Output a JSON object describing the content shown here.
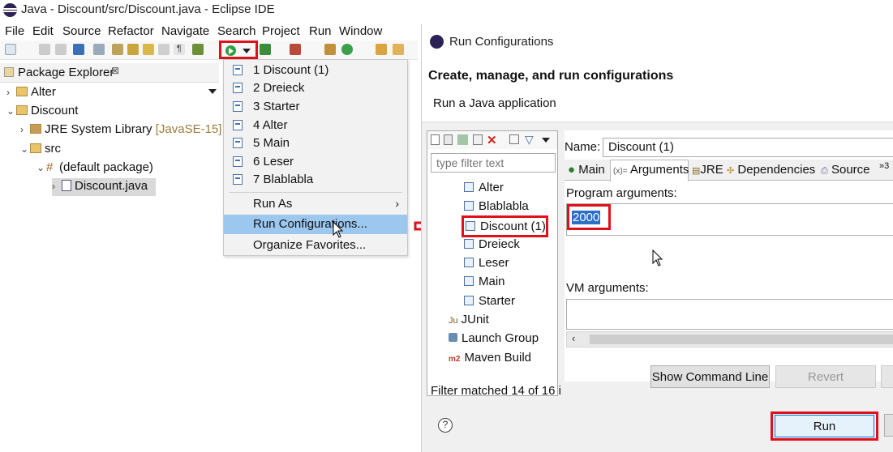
{
  "eclipse": {
    "window_title": "Java - Discount/src/Discount.java - Eclipse IDE",
    "menu": [
      "File",
      "Edit",
      "Source",
      "Refactor",
      "Navigate",
      "Search",
      "Project",
      "Run",
      "Window"
    ],
    "package_explorer": {
      "title": "Package Explorer",
      "close": "⊠",
      "tree": [
        {
          "label": "Alter",
          "extra": ""
        },
        {
          "label": "Discount",
          "extra": ""
        },
        {
          "label": "JRE System Library",
          "extra": "[JavaSE-15]"
        },
        {
          "label": "src",
          "extra": ""
        },
        {
          "label": "(default package)",
          "extra": ""
        },
        {
          "label": "Discount.java",
          "extra": ""
        }
      ]
    },
    "run_menu": {
      "favorites": [
        "1 Discount (1)",
        "2 Dreieck",
        "3 Starter",
        "4 Alter",
        "5 Main",
        "6 Leser",
        "7 Blablabla"
      ],
      "run_as": "Run As",
      "run_configurations": "Run Configurations...",
      "organize_favorites": "Organize Favorites..."
    }
  },
  "dialog": {
    "title": "Run Configurations",
    "heading": "Create, manage, and run configurations",
    "subheading": "Run a Java application",
    "filter_placeholder": "type filter text",
    "configs": [
      "Alter",
      "Blablabla",
      "Discount (1)",
      "Dreieck",
      "Leser",
      "Main",
      "Starter"
    ],
    "categories": [
      {
        "icon": "Ju",
        "label": "JUnit"
      },
      {
        "icon": "",
        "label": "Launch Group"
      },
      {
        "icon": "m2",
        "label": "Maven Build"
      }
    ],
    "filter_status": "Filter matched 14 of 16 i",
    "name_label": "Name:",
    "name_value": "Discount (1)",
    "tabs": [
      "Main",
      "Arguments",
      "JRE",
      "Dependencies",
      "Source",
      "»3"
    ],
    "program_args_label": "Program arguments:",
    "program_args_value": "2000",
    "vm_args_label": "VM arguments:",
    "show_command_line": "Show Command Line",
    "revert": "Revert",
    "run": "Run",
    "help": "?"
  },
  "colors": {
    "highlight_red": "#e0101a",
    "menu_hover": "#9cc7ef",
    "selection_blue": "#2a6fc9"
  }
}
